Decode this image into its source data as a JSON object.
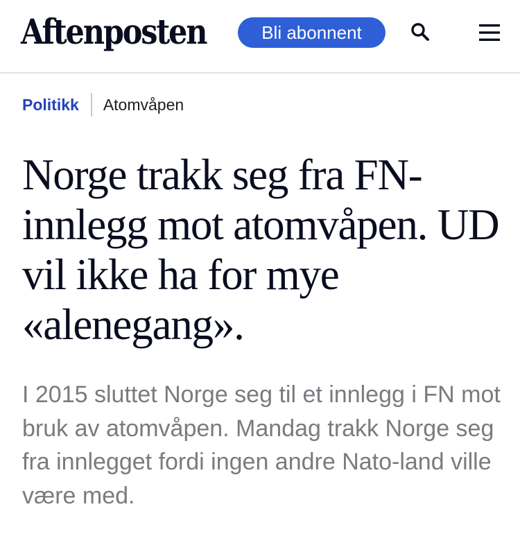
{
  "header": {
    "logo_text": "Aftenposten",
    "subscribe_label": "Bli abonnent",
    "search_icon": "search-icon",
    "menu_icon": "hamburger-menu-icon",
    "colors": {
      "subscribe_bg": "#2e5fd6",
      "logo": "#0a0d1f"
    }
  },
  "breadcrumb": {
    "section": "Politikk",
    "topic": "Atomvåpen",
    "section_color": "#2443b8"
  },
  "article": {
    "headline": "Norge trakk seg fra FN-innlegg mot atomvåpen. UD vil ikke ha for mye «alenegang».",
    "lead": "I 2015 sluttet Norge seg til et innlegg i FN mot bruk av atomvåpen. Mandag trakk Norge seg fra innlegget fordi ingen andre Nato-land ville være med."
  }
}
